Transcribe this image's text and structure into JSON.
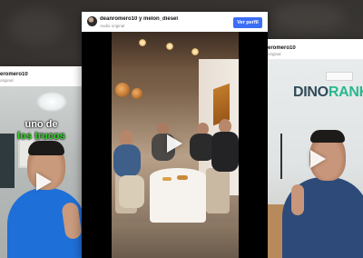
{
  "cards": {
    "left": {
      "username": "eromero10",
      "subline": "original",
      "caption_line1": "uno de",
      "caption_line2": "los trucos"
    },
    "center": {
      "username": "deanromero10 y melon_diesel",
      "subline": "Audio original",
      "follow_label": "Ver perfil"
    },
    "right": {
      "username": "eromero10",
      "subline": "original",
      "brand_part1": "DINO",
      "brand_part2": "RANK"
    }
  },
  "colors": {
    "follow_button": "#3b6ef5",
    "caption_green": "#35d62a",
    "brand_dark": "#2f4b59",
    "brand_green": "#2ab88e"
  },
  "icons": [
    "play-icon",
    "avatar"
  ]
}
